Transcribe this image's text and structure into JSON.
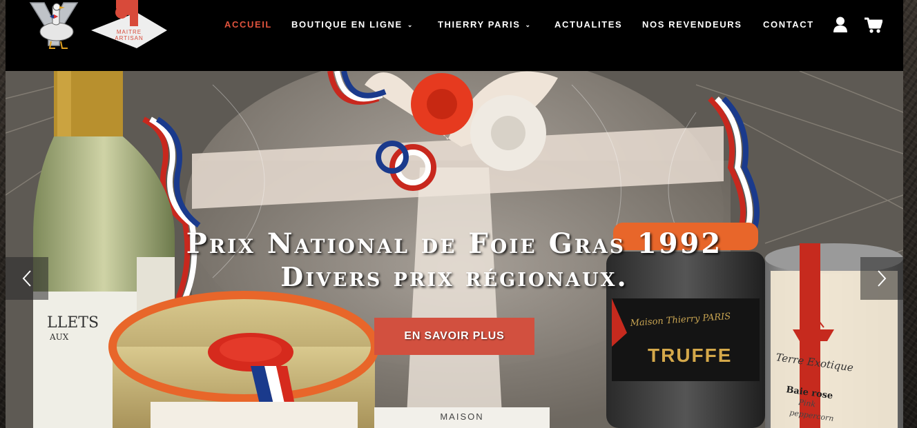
{
  "brand": {
    "logo_text": "MAITRE ARTISAN",
    "accent_color": "#e0533d"
  },
  "nav": {
    "items": [
      {
        "label": "ACCUEIL",
        "active": true,
        "has_dropdown": false
      },
      {
        "label": "BOUTIQUE EN LIGNE",
        "active": false,
        "has_dropdown": true
      },
      {
        "label": "THIERRY PARIS",
        "active": false,
        "has_dropdown": true
      },
      {
        "label": "ACTUALITES",
        "active": false,
        "has_dropdown": false
      },
      {
        "label": "NOS REVENDEURS",
        "active": false,
        "has_dropdown": false
      },
      {
        "label": "CONTACT",
        "active": false,
        "has_dropdown": false
      }
    ],
    "icons": [
      "user-icon",
      "cart-icon"
    ]
  },
  "hero": {
    "title_line1": "Prix National de Foie Gras 1992",
    "title_line2": "Divers prix régionaux.",
    "cta_label": "EN SAVOIR PLUS",
    "cta_color": "#d2503f",
    "products": {
      "wine_label": "LLETS",
      "wine_sub": "AUX",
      "truffle_brand": "Maison Thierry PARIS",
      "truffle_label": "TRUFFE",
      "spice_brand": "Terre Exotique",
      "spice_name": "Baie rose",
      "spice_sub1": "Pink",
      "spice_sub2": "peppercorn",
      "maison_label": "MAISON"
    }
  }
}
